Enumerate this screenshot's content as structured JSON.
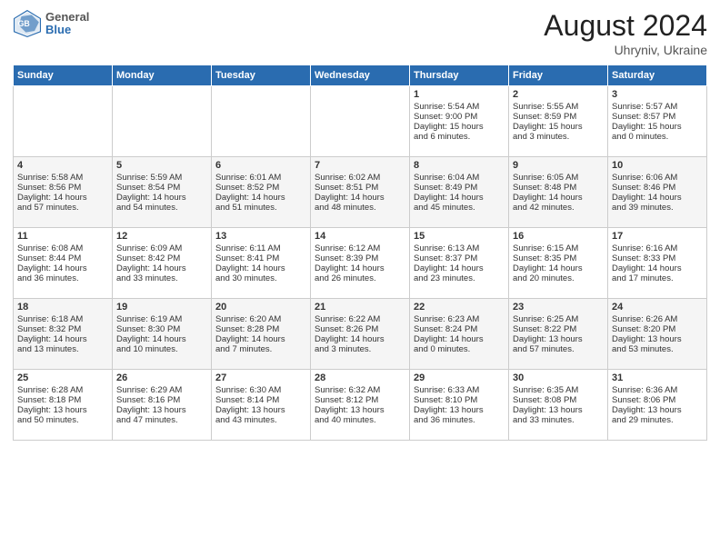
{
  "header": {
    "logo": {
      "general": "General",
      "blue": "Blue"
    },
    "title": "August 2024",
    "location": "Uhryniv, Ukraine"
  },
  "calendar": {
    "days_of_week": [
      "Sunday",
      "Monday",
      "Tuesday",
      "Wednesday",
      "Thursday",
      "Friday",
      "Saturday"
    ],
    "weeks": [
      [
        {
          "day": "",
          "info": ""
        },
        {
          "day": "",
          "info": ""
        },
        {
          "day": "",
          "info": ""
        },
        {
          "day": "",
          "info": ""
        },
        {
          "day": "1",
          "info": "Sunrise: 5:54 AM\nSunset: 9:00 PM\nDaylight: 15 hours\nand 6 minutes."
        },
        {
          "day": "2",
          "info": "Sunrise: 5:55 AM\nSunset: 8:59 PM\nDaylight: 15 hours\nand 3 minutes."
        },
        {
          "day": "3",
          "info": "Sunrise: 5:57 AM\nSunset: 8:57 PM\nDaylight: 15 hours\nand 0 minutes."
        }
      ],
      [
        {
          "day": "4",
          "info": "Sunrise: 5:58 AM\nSunset: 8:56 PM\nDaylight: 14 hours\nand 57 minutes."
        },
        {
          "day": "5",
          "info": "Sunrise: 5:59 AM\nSunset: 8:54 PM\nDaylight: 14 hours\nand 54 minutes."
        },
        {
          "day": "6",
          "info": "Sunrise: 6:01 AM\nSunset: 8:52 PM\nDaylight: 14 hours\nand 51 minutes."
        },
        {
          "day": "7",
          "info": "Sunrise: 6:02 AM\nSunset: 8:51 PM\nDaylight: 14 hours\nand 48 minutes."
        },
        {
          "day": "8",
          "info": "Sunrise: 6:04 AM\nSunset: 8:49 PM\nDaylight: 14 hours\nand 45 minutes."
        },
        {
          "day": "9",
          "info": "Sunrise: 6:05 AM\nSunset: 8:48 PM\nDaylight: 14 hours\nand 42 minutes."
        },
        {
          "day": "10",
          "info": "Sunrise: 6:06 AM\nSunset: 8:46 PM\nDaylight: 14 hours\nand 39 minutes."
        }
      ],
      [
        {
          "day": "11",
          "info": "Sunrise: 6:08 AM\nSunset: 8:44 PM\nDaylight: 14 hours\nand 36 minutes."
        },
        {
          "day": "12",
          "info": "Sunrise: 6:09 AM\nSunset: 8:42 PM\nDaylight: 14 hours\nand 33 minutes."
        },
        {
          "day": "13",
          "info": "Sunrise: 6:11 AM\nSunset: 8:41 PM\nDaylight: 14 hours\nand 30 minutes."
        },
        {
          "day": "14",
          "info": "Sunrise: 6:12 AM\nSunset: 8:39 PM\nDaylight: 14 hours\nand 26 minutes."
        },
        {
          "day": "15",
          "info": "Sunrise: 6:13 AM\nSunset: 8:37 PM\nDaylight: 14 hours\nand 23 minutes."
        },
        {
          "day": "16",
          "info": "Sunrise: 6:15 AM\nSunset: 8:35 PM\nDaylight: 14 hours\nand 20 minutes."
        },
        {
          "day": "17",
          "info": "Sunrise: 6:16 AM\nSunset: 8:33 PM\nDaylight: 14 hours\nand 17 minutes."
        }
      ],
      [
        {
          "day": "18",
          "info": "Sunrise: 6:18 AM\nSunset: 8:32 PM\nDaylight: 14 hours\nand 13 minutes."
        },
        {
          "day": "19",
          "info": "Sunrise: 6:19 AM\nSunset: 8:30 PM\nDaylight: 14 hours\nand 10 minutes."
        },
        {
          "day": "20",
          "info": "Sunrise: 6:20 AM\nSunset: 8:28 PM\nDaylight: 14 hours\nand 7 minutes."
        },
        {
          "day": "21",
          "info": "Sunrise: 6:22 AM\nSunset: 8:26 PM\nDaylight: 14 hours\nand 3 minutes."
        },
        {
          "day": "22",
          "info": "Sunrise: 6:23 AM\nSunset: 8:24 PM\nDaylight: 14 hours\nand 0 minutes."
        },
        {
          "day": "23",
          "info": "Sunrise: 6:25 AM\nSunset: 8:22 PM\nDaylight: 13 hours\nand 57 minutes."
        },
        {
          "day": "24",
          "info": "Sunrise: 6:26 AM\nSunset: 8:20 PM\nDaylight: 13 hours\nand 53 minutes."
        }
      ],
      [
        {
          "day": "25",
          "info": "Sunrise: 6:28 AM\nSunset: 8:18 PM\nDaylight: 13 hours\nand 50 minutes."
        },
        {
          "day": "26",
          "info": "Sunrise: 6:29 AM\nSunset: 8:16 PM\nDaylight: 13 hours\nand 47 minutes."
        },
        {
          "day": "27",
          "info": "Sunrise: 6:30 AM\nSunset: 8:14 PM\nDaylight: 13 hours\nand 43 minutes."
        },
        {
          "day": "28",
          "info": "Sunrise: 6:32 AM\nSunset: 8:12 PM\nDaylight: 13 hours\nand 40 minutes."
        },
        {
          "day": "29",
          "info": "Sunrise: 6:33 AM\nSunset: 8:10 PM\nDaylight: 13 hours\nand 36 minutes."
        },
        {
          "day": "30",
          "info": "Sunrise: 6:35 AM\nSunset: 8:08 PM\nDaylight: 13 hours\nand 33 minutes."
        },
        {
          "day": "31",
          "info": "Sunrise: 6:36 AM\nSunset: 8:06 PM\nDaylight: 13 hours\nand 29 minutes."
        }
      ]
    ]
  }
}
